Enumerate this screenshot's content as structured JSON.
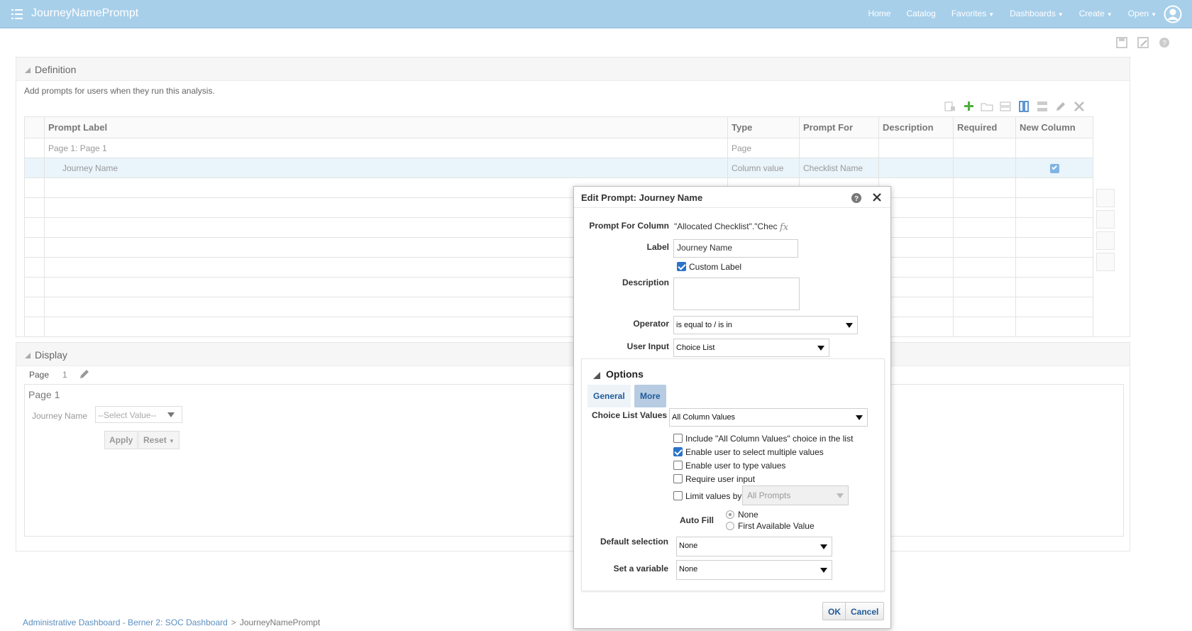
{
  "app": {
    "title": "JourneyNamePrompt"
  },
  "nav": {
    "items": [
      {
        "label": "Home",
        "caret": false
      },
      {
        "label": "Catalog",
        "caret": false
      },
      {
        "label": "Favorites",
        "caret": true
      },
      {
        "label": "Dashboards",
        "caret": true
      },
      {
        "label": "Create",
        "caret": true
      },
      {
        "label": "Open",
        "caret": true
      }
    ]
  },
  "definition": {
    "title": "Definition",
    "description": "Add prompts for users when they run this analysis.",
    "columns": [
      "Prompt Label",
      "Type",
      "Prompt For",
      "Description",
      "Required",
      "New Column"
    ],
    "rows": [
      {
        "label": "Page 1: Page 1",
        "type": "Page",
        "prompt_for": "",
        "description": "",
        "required": "",
        "new_column": false
      },
      {
        "label": "Journey Name",
        "type": "Column value",
        "prompt_for": "Checklist Name",
        "description": "",
        "required": "",
        "new_column": true
      }
    ]
  },
  "display": {
    "title": "Display",
    "page_label": "Page",
    "page_value": "1",
    "page_title": "Page 1",
    "prompt_label": "Journey Name",
    "select_placeholder": "--Select Value--",
    "apply_label": "Apply",
    "reset_label": "Reset"
  },
  "breadcrumb": {
    "link": "Administrative Dashboard - Berner 2: SOC Dashboard",
    "separator": ">",
    "current": "JourneyNamePrompt"
  },
  "dialog": {
    "title": "Edit Prompt: Journey Name",
    "prompt_for_column_label": "Prompt For Column",
    "prompt_for_column_value": "\"Allocated Checklist\".\"Chec",
    "fx_label": "fx",
    "label_label": "Label",
    "label_value": "Journey Name",
    "custom_label": "Custom Label",
    "custom_label_checked": true,
    "description_label": "Description",
    "description_value": "",
    "operator_label": "Operator",
    "operator_value": "is equal to / is in",
    "user_input_label": "User Input",
    "user_input_value": "Choice List",
    "options": {
      "title": "Options",
      "tabs": [
        "General",
        "More"
      ],
      "active_tab": "More",
      "choice_list_values_label": "Choice List Values",
      "choice_list_values_value": "All Column Values",
      "checkboxes": [
        {
          "label": "Include \"All Column Values\" choice in the list",
          "checked": false
        },
        {
          "label": "Enable user to select multiple values",
          "checked": true
        },
        {
          "label": "Enable user to type values",
          "checked": false
        },
        {
          "label": "Require user input",
          "checked": false
        }
      ],
      "limit_values_label": "Limit values by",
      "limit_values_checked": false,
      "limit_values_value": "All Prompts",
      "auto_fill_label": "Auto Fill",
      "auto_fill_options": [
        "None",
        "First Available Value"
      ],
      "auto_fill_selected": "None",
      "default_selection_label": "Default selection",
      "default_selection_value": "None",
      "set_variable_label": "Set a variable",
      "set_variable_value": "None"
    },
    "ok_label": "OK",
    "cancel_label": "Cancel"
  },
  "colors": {
    "topbar": "#a7cfea",
    "link": "#5b8fbf",
    "checkbox_checked": "#2a73c9",
    "tab_active": "#b7cbe2"
  }
}
